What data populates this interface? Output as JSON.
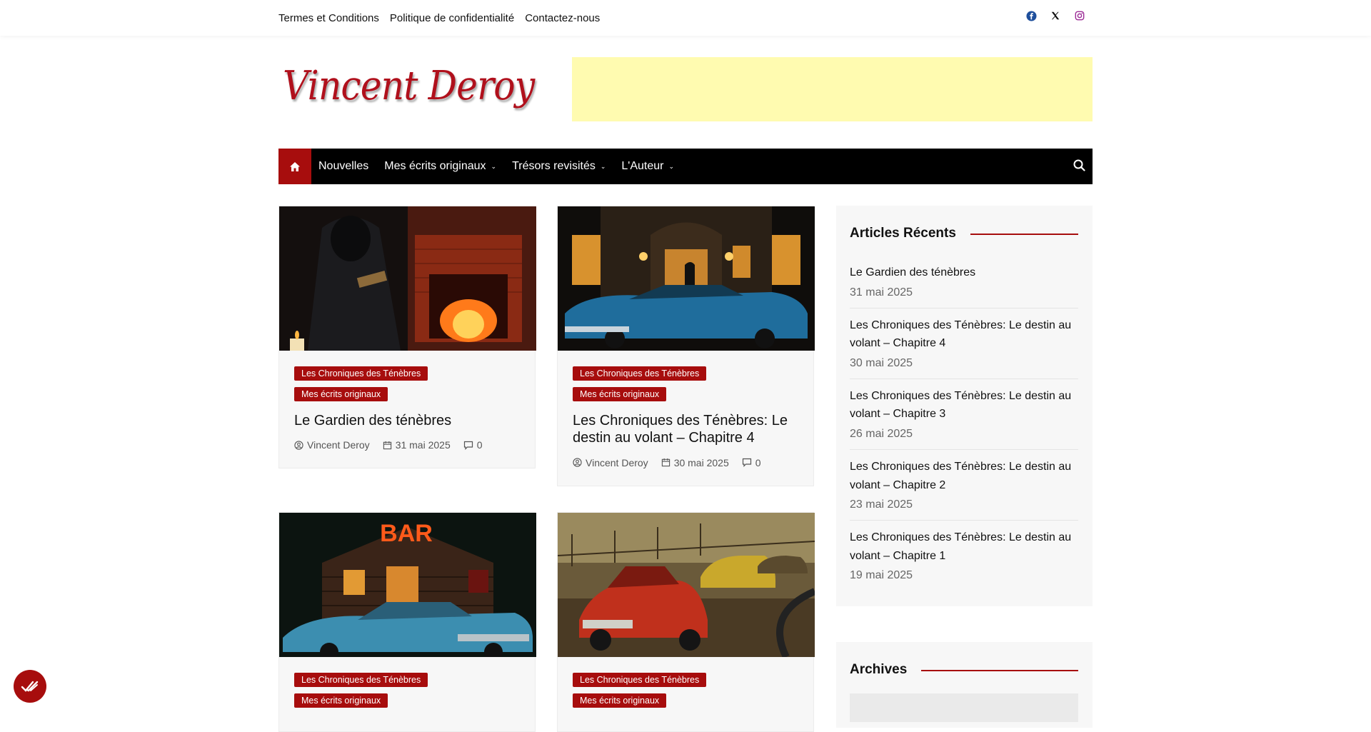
{
  "topbar": {
    "links": [
      "Termes et Conditions",
      "Politique de confidentialité",
      "Contactez-nous"
    ],
    "social_icons": [
      "facebook-icon",
      "x-icon",
      "instagram-icon"
    ]
  },
  "header": {
    "logo_text": "Vincent Deroy"
  },
  "nav": {
    "home_icon": "home-icon",
    "items": [
      {
        "label": "Nouvelles"
      },
      {
        "label": "Mes écrits originaux"
      },
      {
        "label": "Trésors revisités"
      },
      {
        "label": "L'Auteur"
      }
    ],
    "search_icon": "search-icon"
  },
  "posts": [
    {
      "categories": [
        "Les Chroniques des Ténèbres",
        "Mes écrits originaux"
      ],
      "title": "Le Gardien des ténèbres",
      "author": "Vincent Deroy",
      "date": "31 mai 2025",
      "comments": "0"
    },
    {
      "categories": [
        "Les Chroniques des Ténèbres",
        "Mes écrits originaux"
      ],
      "title": "Les Chroniques des Ténèbres: Le destin au volant – Chapitre 4",
      "author": "Vincent Deroy",
      "date": "30 mai 2025",
      "comments": "0"
    },
    {
      "categories": [
        "Les Chroniques des Ténèbres",
        "Mes écrits originaux"
      ]
    },
    {
      "categories": [
        "Les Chroniques des Ténèbres",
        "Mes écrits originaux"
      ]
    }
  ],
  "recent": {
    "title": "Articles Récents",
    "items": [
      {
        "title": "Le Gardien des ténèbres",
        "date": "31 mai 2025"
      },
      {
        "title": "Les Chroniques des Ténèbres: Le destin au volant – Chapitre 4",
        "date": "30 mai 2025"
      },
      {
        "title": "Les Chroniques des Ténèbres: Le destin au volant – Chapitre 3",
        "date": "26 mai 2025"
      },
      {
        "title": "Les Chroniques des Ténèbres: Le destin au volant – Chapitre 2",
        "date": "23 mai 2025"
      },
      {
        "title": "Les Chroniques des Ténèbres: Le destin au volant – Chapitre 1",
        "date": "19 mai 2025"
      }
    ]
  },
  "archives": {
    "title": "Archives"
  },
  "colors": {
    "accent": "#a70d0d",
    "nav_bg": "#000000",
    "ad_bg": "#fffbb0"
  }
}
